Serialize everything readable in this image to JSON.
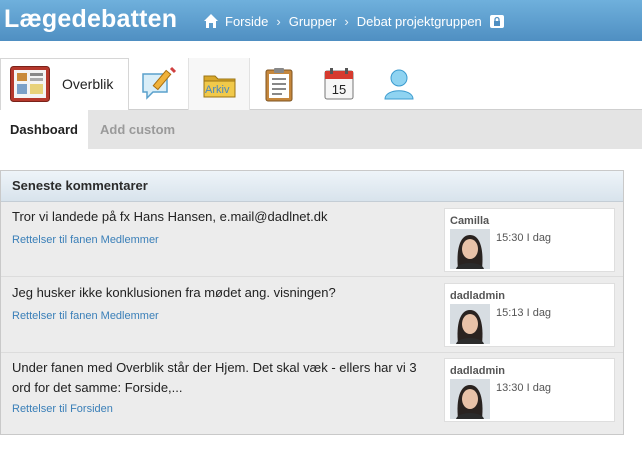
{
  "app": {
    "title": "Lægedebatten"
  },
  "breadcrumb": {
    "items": [
      "Forside",
      "Grupper",
      "Debat projektgruppen"
    ]
  },
  "icon_tabs": {
    "overblik_label": "Overblik",
    "arkiv_label": "Arkiv",
    "tabs": [
      "overblik",
      "edit",
      "arkiv",
      "clipboard",
      "calendar",
      "user"
    ]
  },
  "calendar_icon_day": "15",
  "sub_tabs": [
    "Dashboard",
    "Add custom"
  ],
  "panel": {
    "title": "Seneste kommentarer",
    "comments": [
      {
        "text": "Tror vi landede på fx Hans Hansen, e.mail@dadlnet.dk",
        "link": "Rettelser til fanen Medlemmer",
        "author": "Camilla",
        "time": "15:30 I dag"
      },
      {
        "text": "Jeg husker ikke konklusionen fra mødet ang. visningen?",
        "link": "Rettelser til fanen Medlemmer",
        "author": "dadladmin",
        "time": "15:13 I dag"
      },
      {
        "text": "Under fanen med Overblik står der Hjem. Det skal væk - ellers har vi 3 ord for det samme: Forside,...",
        "link": "Rettelser til Forsiden",
        "author": "dadladmin",
        "time": "13:30 I dag"
      }
    ]
  },
  "colors": {
    "header": "#5b9bd0",
    "link": "#3a7fb8",
    "panel_bg": "#ececec"
  }
}
